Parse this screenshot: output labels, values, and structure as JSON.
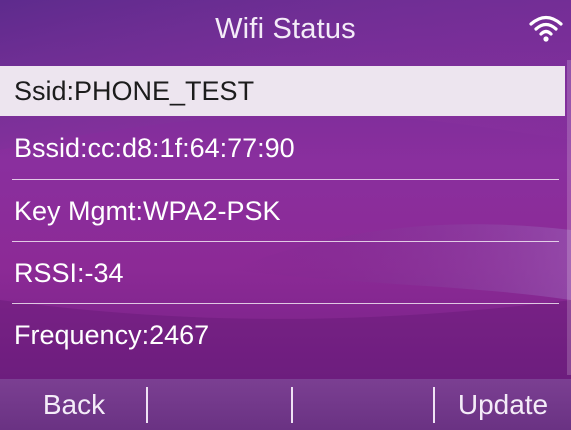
{
  "header": {
    "title": "Wifi Status",
    "status_icon": "wifi-signal-icon"
  },
  "list": {
    "items": [
      {
        "label": "Ssid:PHONE_TEST",
        "selected": true
      },
      {
        "label": "Bssid:cc:d8:1f:64:77:90",
        "selected": false
      },
      {
        "label": "Key Mgmt:WPA2-PSK",
        "selected": false
      },
      {
        "label": "RSSI:-34",
        "selected": false
      },
      {
        "label": "Frequency:2467",
        "selected": false
      }
    ]
  },
  "softkeys": {
    "back": "Back",
    "key2": "",
    "key3": "",
    "update": "Update"
  },
  "colors": {
    "background": "#8a2f9e",
    "selected_row": "#ede5ef",
    "softkey_bar": "#723a8b"
  }
}
